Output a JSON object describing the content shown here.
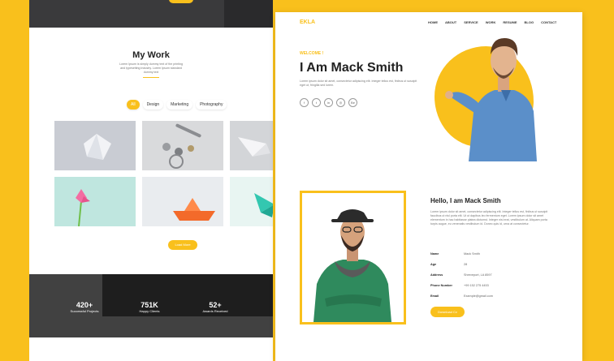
{
  "colors": {
    "accent": "#f9c01c",
    "page_bg": "#f9c01c",
    "dark": "#222222"
  },
  "left_page": {
    "section_title": "My Work",
    "section_subtitle": "Lorem Ipsum is simply dummy text of the printing and typesetting industry. Lorem Ipsum standard dummy text",
    "filters": [
      {
        "label": "All",
        "active": true
      },
      {
        "label": "Design",
        "active": false
      },
      {
        "label": "Marketing",
        "active": false
      },
      {
        "label": "Photography",
        "active": false
      }
    ],
    "load_more": "Load More",
    "stats": [
      {
        "value": "420+",
        "label": "Successful Projects"
      },
      {
        "value": "751K",
        "label": "Happy Clients"
      },
      {
        "value": "52+",
        "label": "Awards Received"
      }
    ]
  },
  "right_page": {
    "logo": "EKLA",
    "nav": [
      "HOME",
      "ABOUT",
      "SERVICE",
      "WORK",
      "RESUME",
      "BLOG",
      "CONTACT"
    ],
    "welcome": "WELCOME !",
    "headline": "I Am Mack Smith",
    "intro": "Lorem ipsum dolor sit amet, consectetur adipiscing elit. Integer tellus est, finibus ut suscipit eget ut, fringilla sed lorem.",
    "socials": [
      "f",
      "t",
      "in",
      "◎",
      "Be"
    ],
    "about": {
      "title": "Hello, I am Mack Smith",
      "text": "Lorem ipsum dolor sit amet, consectetur adipiscing elit. Integer tellus est, finibus ut suscipit faucibus ut nisl porta elit. Ut ut dapibus leo fermentum eget. Lorem ipsum dolor sit amet elementum in hac habitasse platea dictumst. Integer nisl erat, vestibulum at. Aliquam porta turpis augue, eu venenatis vestibulum id. Donec quis id, urna at consectetur.",
      "info": [
        {
          "key": "Name",
          "value": "Mack Smith"
        },
        {
          "key": "Age",
          "value": "28"
        },
        {
          "key": "Address",
          "value": "Shreveport, LA 8597"
        },
        {
          "key": "Phone Number",
          "value": "+99 152 275 4453"
        },
        {
          "key": "Email",
          "value": "Example@gmail.com"
        }
      ],
      "download": "Download Cv"
    }
  }
}
